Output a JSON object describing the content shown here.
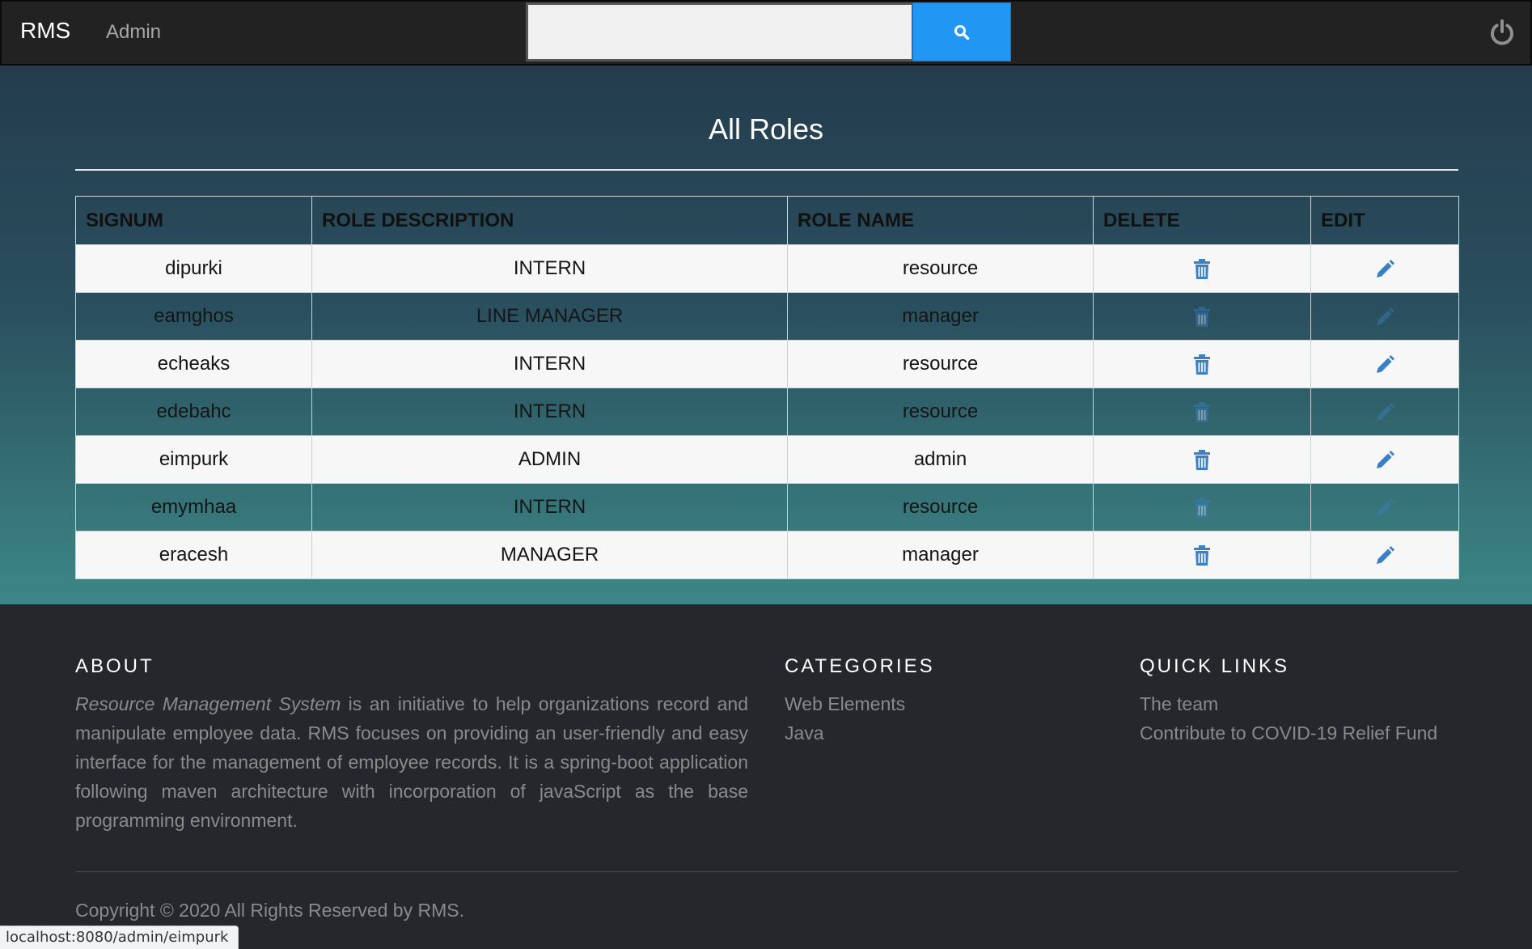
{
  "nav": {
    "brand": "RMS",
    "admin_link": "Admin",
    "search_value": "",
    "search_placeholder": "",
    "search_icon": "search-icon",
    "power_icon": "power-icon",
    "accent": "#2196f3"
  },
  "main": {
    "title": "All Roles",
    "headers": [
      "SIGNUM",
      "ROLE DESCRIPTION",
      "ROLE NAME",
      "DELETE",
      "EDIT"
    ],
    "rows": [
      {
        "signum": "dipurki",
        "description": "INTERN",
        "role": "resource"
      },
      {
        "signum": "eamghos",
        "description": "LINE MANAGER",
        "role": "manager"
      },
      {
        "signum": "echeaks",
        "description": "INTERN",
        "role": "resource"
      },
      {
        "signum": "edebahc",
        "description": "INTERN",
        "role": "resource"
      },
      {
        "signum": "eimpurk",
        "description": "ADMIN",
        "role": "admin"
      },
      {
        "signum": "emymhaa",
        "description": "INTERN",
        "role": "resource"
      },
      {
        "signum": "eracesh",
        "description": "MANAGER",
        "role": "manager"
      }
    ],
    "delete_icon": "trash-icon",
    "edit_icon": "pencil-icon"
  },
  "footer": {
    "about_heading": "ABOUT",
    "about_italic": "Resource Management System",
    "about_text": " is an initiative to help organizations record and manipulate employee data. RMS focuses on providing an user-friendly and easy interface for the management of employee records. It is a spring-boot application following maven architecture with incorporation of javaScript as the base programming environment.",
    "categories_heading": "CATEGORIES",
    "categories": [
      "Web Elements",
      "Java"
    ],
    "quicklinks_heading": "QUICK LINKS",
    "quicklinks": [
      "The team",
      "Contribute to COVID-19 Relief Fund"
    ],
    "copyright": "Copyright © 2020 All Rights Reserved by RMS."
  },
  "status_bar": {
    "url": "localhost:8080/admin/eimpurk"
  }
}
